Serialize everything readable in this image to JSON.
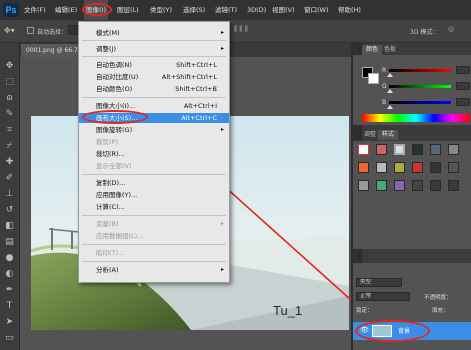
{
  "app": {
    "logo": "Ps"
  },
  "menubar": {
    "items": [
      "文件(F)",
      "编辑(E)",
      "图像(I)",
      "图层(L)",
      "类型(Y)",
      "选择(S)",
      "滤镜(T)",
      "3D(D)",
      "视图(V)",
      "窗口(W)",
      "帮助(H)"
    ]
  },
  "options_bar": {
    "auto_select": "自动选择：",
    "mode_3d": "3D 模式："
  },
  "document_tab": {
    "title": "0001.png @ 66.7"
  },
  "image_menu": {
    "items": [
      {
        "label": "模式(M)",
        "shortcut": "",
        "submenu": true,
        "disabled": false
      },
      {
        "label": "调整(J)",
        "shortcut": "",
        "submenu": true,
        "disabled": false
      },
      {
        "label": "自动色调(N)",
        "shortcut": "Shift+Ctrl+L",
        "submenu": false,
        "disabled": false
      },
      {
        "label": "自动对比度(U)",
        "shortcut": "Alt+Shift+Ctrl+L",
        "submenu": false,
        "disabled": false
      },
      {
        "label": "自动颜色(O)",
        "shortcut": "Shift+Ctrl+B",
        "submenu": false,
        "disabled": false
      },
      {
        "label": "图像大小(I)...",
        "shortcut": "Alt+Ctrl+I",
        "submenu": false,
        "disabled": false
      },
      {
        "label": "画布大小(S)...",
        "shortcut": "Alt+Ctrl+C",
        "submenu": false,
        "disabled": false,
        "highlighted": true
      },
      {
        "label": "图像旋转(G)",
        "shortcut": "",
        "submenu": true,
        "disabled": false
      },
      {
        "label": "裁剪(P)",
        "shortcut": "",
        "submenu": false,
        "disabled": true
      },
      {
        "label": "裁切(R)...",
        "shortcut": "",
        "submenu": false,
        "disabled": false
      },
      {
        "label": "显示全部(V)",
        "shortcut": "",
        "submenu": false,
        "disabled": true
      },
      {
        "label": "复制(D)...",
        "shortcut": "",
        "submenu": false,
        "disabled": false
      },
      {
        "label": "应用图像(Y)...",
        "shortcut": "",
        "submenu": false,
        "disabled": false
      },
      {
        "label": "计算(C)...",
        "shortcut": "",
        "submenu": false,
        "disabled": false
      },
      {
        "label": "变量(B)",
        "shortcut": "",
        "submenu": true,
        "disabled": true
      },
      {
        "label": "应用数据组(L)...",
        "shortcut": "",
        "submenu": false,
        "disabled": true
      },
      {
        "label": "陷印(T)...",
        "shortcut": "",
        "submenu": false,
        "disabled": true
      },
      {
        "label": "分析(A)",
        "shortcut": "",
        "submenu": true,
        "disabled": false
      }
    ]
  },
  "canvas": {
    "watermark": "Tu_1"
  },
  "color_panel": {
    "tabs": [
      "颜色",
      "色板"
    ],
    "channels": [
      {
        "label": "R",
        "value": "",
        "color": "#ff0000"
      },
      {
        "label": "G",
        "value": "",
        "color": "#00ff00"
      },
      {
        "label": "B",
        "value": "",
        "color": "#0000ff"
      }
    ]
  },
  "style_panel": {
    "tabs": [
      "调整",
      "样式"
    ]
  },
  "layers_panel": {
    "tabs": [
      "图层",
      "通道",
      "路径"
    ],
    "kind_filter": "类型",
    "blend_mode": "正常",
    "opacity_label": "不透明度：",
    "lock_label": "锁定：",
    "fill_label": "填充：",
    "layer_name": "背景"
  },
  "icons": {
    "eye": "👁",
    "submenu_arrow": "▸"
  }
}
